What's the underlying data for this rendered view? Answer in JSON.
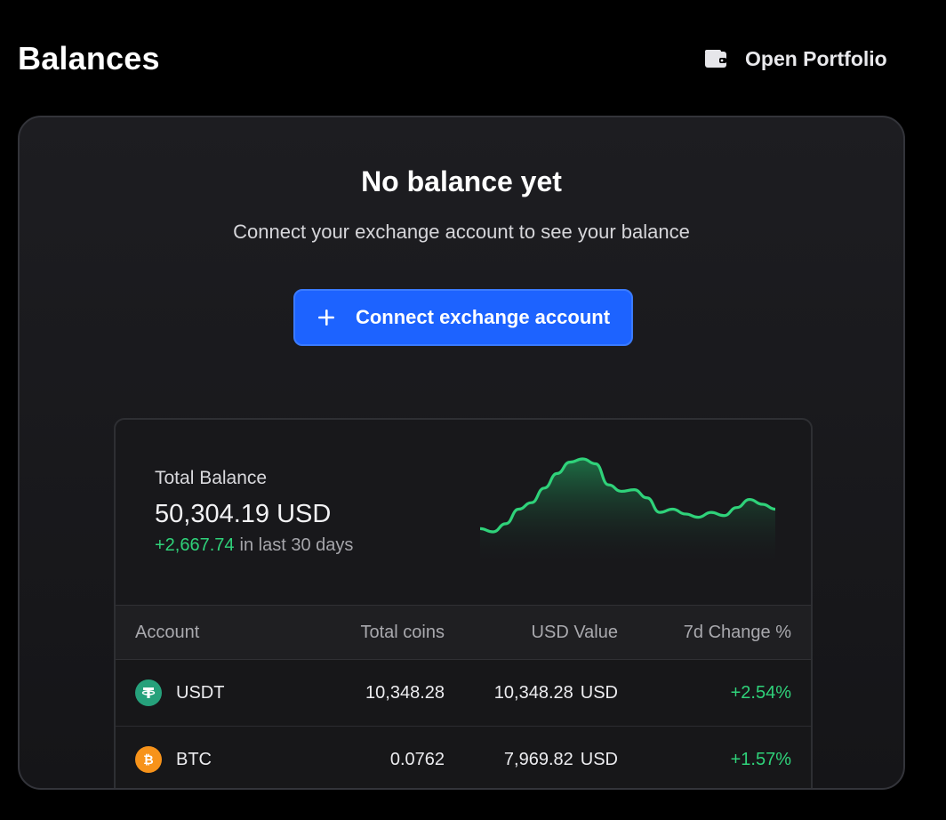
{
  "header": {
    "title": "Balances",
    "open_portfolio_label": "Open Portfolio",
    "open_portfolio_icon": "wallet-icon"
  },
  "empty_state": {
    "title": "No balance yet",
    "subtitle": "Connect your exchange account to see your balance",
    "button_label": "Connect exchange account",
    "button_icon": "plus-icon",
    "button_color": "#1d63ff"
  },
  "preview": {
    "total_label": "Total Balance",
    "total_value": "50,304.19 USD",
    "change_value": "+2,667.74",
    "change_period": "in last 30 days",
    "positive_color": "#2fd27a",
    "sparkline": [
      30,
      28,
      33,
      42,
      46,
      55,
      64,
      71,
      73,
      70,
      57,
      53,
      54,
      49,
      40,
      42,
      39,
      37,
      40,
      38,
      43,
      48,
      45,
      42
    ]
  },
  "table": {
    "headers": [
      "Account",
      "Total coins",
      "USD Value",
      "7d Change %"
    ],
    "rows": [
      {
        "coin": "USDT",
        "icon": "usdt-icon",
        "total_coins": "10,348.28",
        "usd_value": "10,348.28",
        "usd_unit": "USD",
        "change": "+2.54%"
      },
      {
        "coin": "BTC",
        "icon": "btc-icon",
        "total_coins": "0.0762",
        "usd_value": "7,969.82",
        "usd_unit": "USD",
        "change": "+1.57%"
      }
    ]
  }
}
